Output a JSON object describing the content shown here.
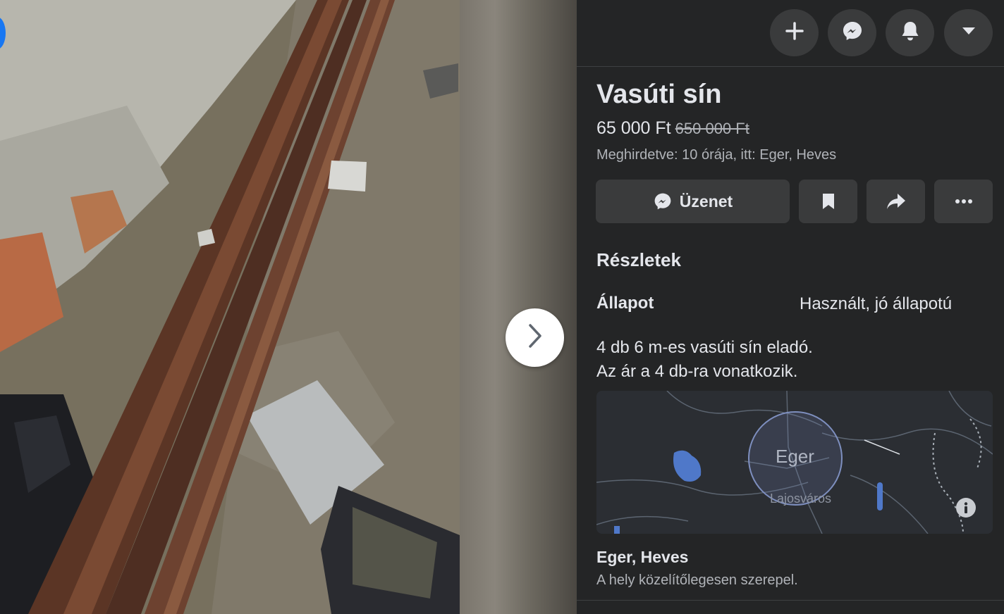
{
  "header": {
    "buttons": [
      {
        "name": "create-button",
        "icon": "plus-icon"
      },
      {
        "name": "messenger-button",
        "icon": "messenger-icon"
      },
      {
        "name": "notifications-button",
        "icon": "bell-icon"
      },
      {
        "name": "account-menu-button",
        "icon": "caret-down-icon"
      }
    ]
  },
  "listing": {
    "title": "Vasúti sín",
    "price": "65 000 Ft",
    "original_price": "650 000 Ft",
    "meta": "Meghirdetve: 10 órája, itt: Eger, Heves"
  },
  "actions": {
    "message_label": "Üzenet",
    "save_icon": "bookmark-icon",
    "share_icon": "share-icon",
    "more_icon": "more-icon"
  },
  "details": {
    "heading": "Részletek",
    "condition_label": "Állapot",
    "condition_value": "Használt, jó állapotú",
    "description_lines": [
      "4 db 6 m-es vasúti sín eladó.",
      "Az ár a 4 db-ra vonatkozik."
    ]
  },
  "map": {
    "city_label": "Eger",
    "district_label": "Lajosváros",
    "info_icon": "info-icon"
  },
  "location": {
    "title": "Eger, Heves",
    "note": "A hely közelítőlegesen szerepel."
  },
  "colors": {
    "panel_bg": "#242526",
    "button_bg": "#3a3b3c",
    "text_primary": "#e4e6eb",
    "text_secondary": "#b0b3b8",
    "accent": "#1877f2"
  }
}
